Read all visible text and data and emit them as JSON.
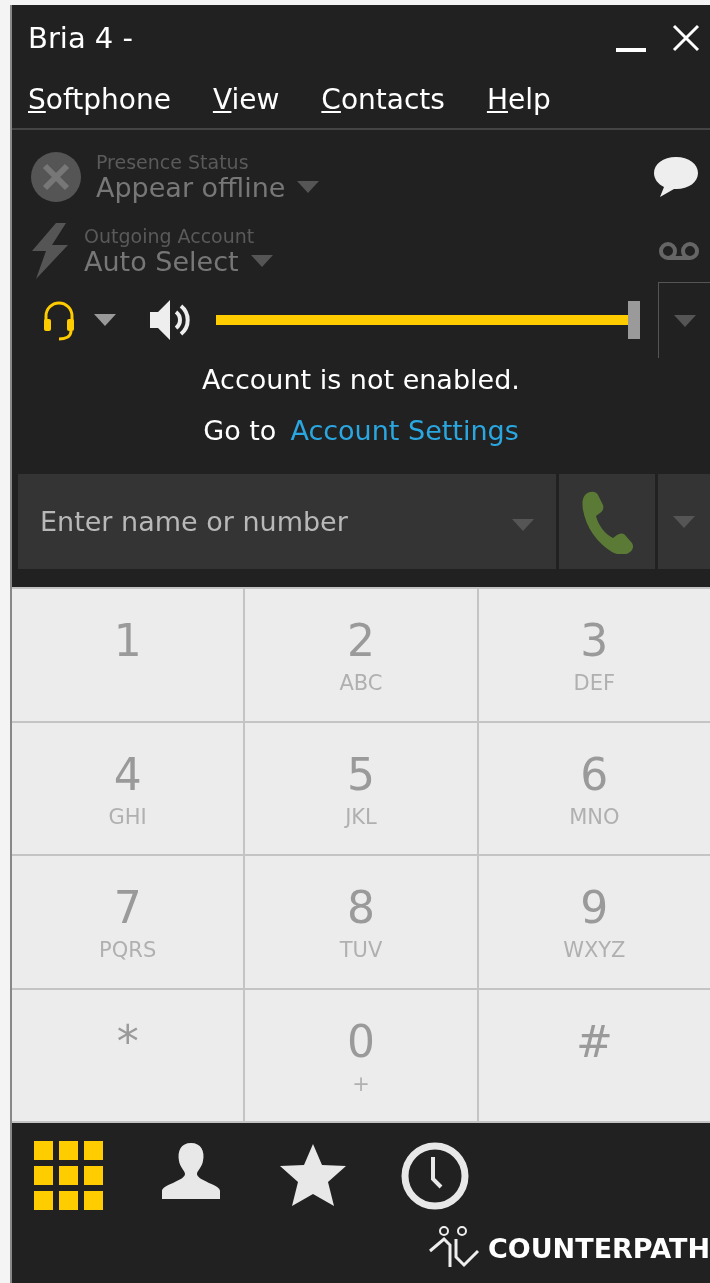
{
  "window": {
    "title": "Bria 4 -"
  },
  "menu": [
    {
      "label": "Softphone"
    },
    {
      "label": "View"
    },
    {
      "label": "Contacts"
    },
    {
      "label": "Help"
    }
  ],
  "presence": {
    "label": "Presence Status",
    "value": "Appear offline"
  },
  "outgoing_account": {
    "label": "Outgoing Account",
    "value": "Auto Select"
  },
  "volume": {
    "level": 0.98
  },
  "message": {
    "line": "Account is not enabled.",
    "prefix": "Go to",
    "link": "Account Settings"
  },
  "dial": {
    "placeholder": "Enter name or number"
  },
  "keypad": [
    {
      "digit": "1"
    },
    {
      "digit": "2",
      "letters": "ABC"
    },
    {
      "digit": "3",
      "letters": "DEF"
    },
    {
      "digit": "4",
      "letters": "GHI"
    },
    {
      "digit": "5",
      "letters": "JKL"
    },
    {
      "digit": "6",
      "letters": "MNO"
    },
    {
      "digit": "7",
      "letters": "PQRS"
    },
    {
      "digit": "8",
      "letters": "TUV"
    },
    {
      "digit": "9",
      "letters": "WXYZ"
    },
    {
      "digit": "*"
    },
    {
      "digit": "0",
      "letters": "+"
    },
    {
      "digit": "#"
    }
  ],
  "bottom_tabs": [
    {
      "kind": "keypad",
      "selected": true
    },
    {
      "kind": "contacts",
      "selected": false
    },
    {
      "kind": "favorites",
      "selected": false
    },
    {
      "kind": "history",
      "selected": false
    }
  ],
  "brand": "COUNTERPATH"
}
